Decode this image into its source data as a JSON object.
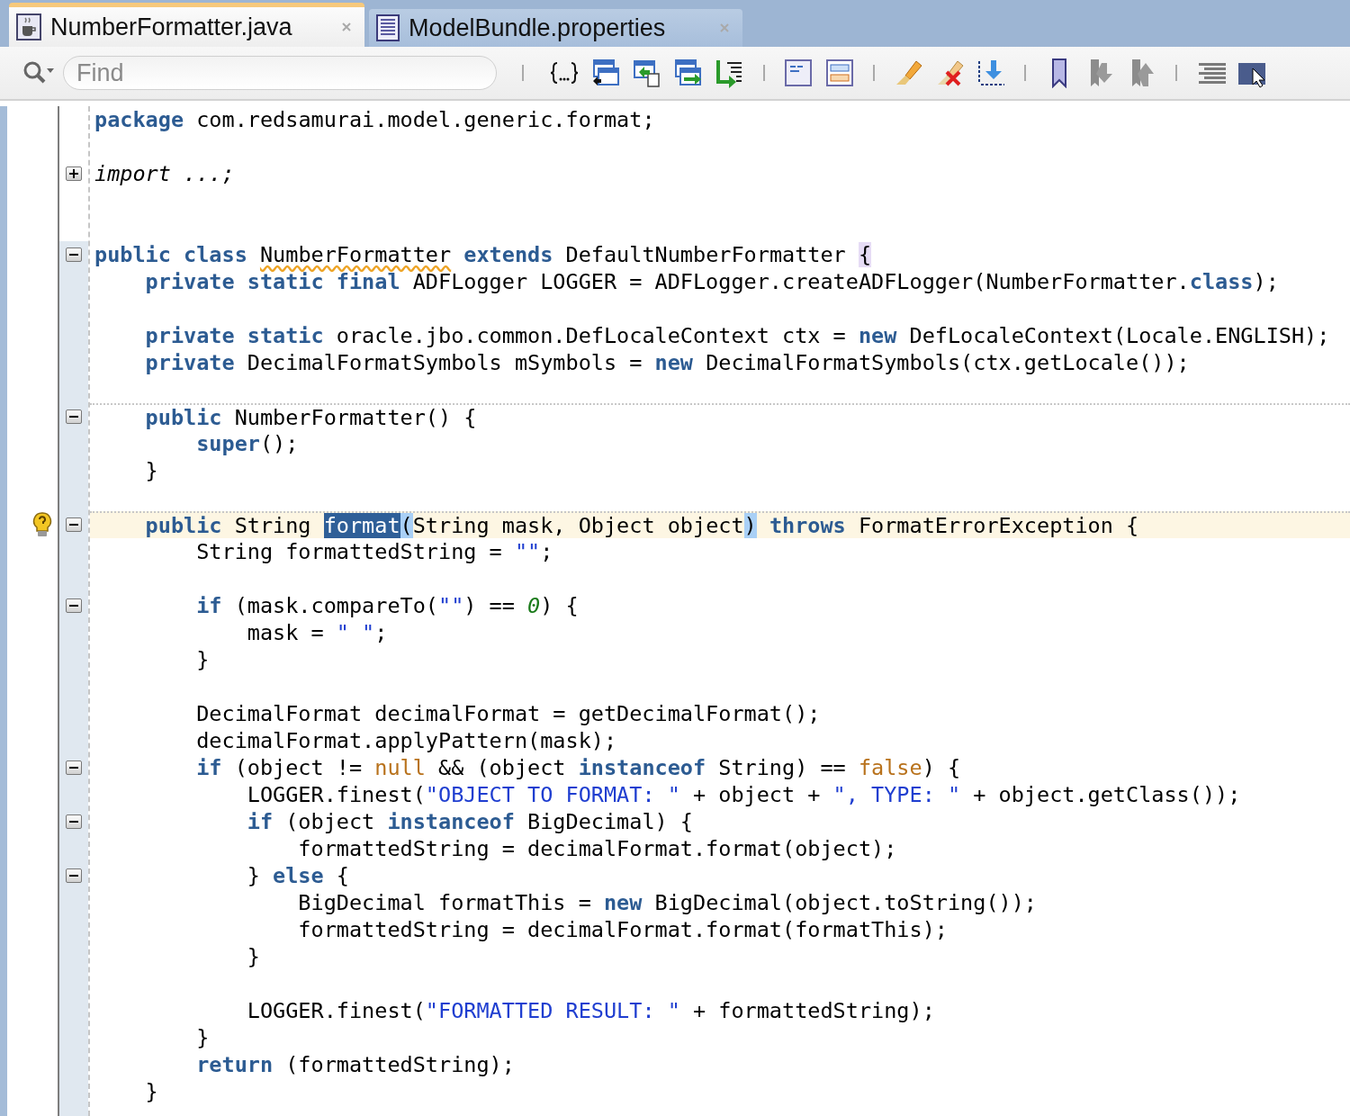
{
  "tabs": [
    {
      "label": "NumberFormatter.java",
      "kind": "java",
      "selected": true
    },
    {
      "label": "ModelBundle.properties",
      "kind": "properties",
      "selected": false
    }
  ],
  "search": {
    "placeholder": "Find"
  },
  "code": [
    {
      "kind": "code",
      "tokens": [
        {
          "kind": "keyword",
          "text": "package"
        },
        {
          "kind": "plain",
          "text": " com.redsamurai.model.generic.format;"
        }
      ]
    },
    {
      "kind": "blank"
    },
    {
      "kind": "code",
      "fold_marker": {
        "expanded": false
      },
      "tokens": [
        {
          "kind": "italic",
          "text": "import ...;"
        }
      ]
    },
    {
      "kind": "blank"
    },
    {
      "kind": "blank"
    },
    {
      "kind": "code",
      "fold_marker": {
        "expanded": true
      },
      "tokens": [
        {
          "kind": "keyword",
          "text": "public class "
        },
        {
          "kind": "warning",
          "text": "NumberFormatter"
        },
        {
          "kind": "keyword",
          "text": " extends"
        },
        {
          "kind": "plain",
          "text": " DefaultNumberFormatter "
        },
        {
          "kind": "brace",
          "text": "{"
        }
      ]
    },
    {
      "kind": "code",
      "tokens": [
        {
          "kind": "keyword",
          "text": "    private static final"
        },
        {
          "kind": "plain",
          "text": " ADFLogger LOGGER = ADFLogger.createADFLogger(NumberFormatter."
        },
        {
          "kind": "keyword",
          "text": "class"
        },
        {
          "kind": "plain",
          "text": ");"
        }
      ]
    },
    {
      "kind": "blank"
    },
    {
      "kind": "code",
      "tokens": [
        {
          "kind": "keyword",
          "text": "    private static"
        },
        {
          "kind": "plain",
          "text": " oracle.jbo.common.DefLocaleContext ctx = "
        },
        {
          "kind": "keyword",
          "text": "new"
        },
        {
          "kind": "plain",
          "text": " DefLocaleContext(Locale.ENGLISH);"
        }
      ]
    },
    {
      "kind": "code",
      "tokens": [
        {
          "kind": "keyword",
          "text": "    private"
        },
        {
          "kind": "plain",
          "text": " DecimalFormatSymbols mSymbols = "
        },
        {
          "kind": "keyword",
          "text": "new"
        },
        {
          "kind": "plain",
          "text": " DecimalFormatSymbols(ctx.getLocale());"
        }
      ]
    },
    {
      "kind": "blank"
    },
    {
      "kind": "code",
      "separator": true,
      "fold_marker": {
        "expanded": true
      },
      "tokens": [
        {
          "kind": "keyword",
          "text": "    public"
        },
        {
          "kind": "plain",
          "text": " NumberFormatter() {"
        }
      ]
    },
    {
      "kind": "code",
      "tokens": [
        {
          "kind": "keyword",
          "text": "        super"
        },
        {
          "kind": "plain",
          "text": "();"
        }
      ]
    },
    {
      "kind": "code",
      "tokens": [
        {
          "kind": "plain",
          "text": "    }"
        }
      ]
    },
    {
      "kind": "blank"
    },
    {
      "kind": "code",
      "separator": true,
      "current": true,
      "hint": true,
      "fold_marker": {
        "expanded": true
      },
      "tokens": [
        {
          "kind": "keyword",
          "text": "    public"
        },
        {
          "kind": "plain",
          "text": " String "
        },
        {
          "kind": "selection",
          "text": "format"
        },
        {
          "kind": "match",
          "text": "("
        },
        {
          "kind": "plain",
          "text": "String mask, Object object"
        },
        {
          "kind": "match",
          "text": ")"
        },
        {
          "kind": "keyword",
          "text": " throws"
        },
        {
          "kind": "plain",
          "text": " FormatErrorException {"
        }
      ]
    },
    {
      "kind": "code",
      "tokens": [
        {
          "kind": "plain",
          "text": "        String formattedString = "
        },
        {
          "kind": "string",
          "text": "\"\""
        },
        {
          "kind": "plain",
          "text": ";"
        }
      ]
    },
    {
      "kind": "blank"
    },
    {
      "kind": "code",
      "fold_marker": {
        "expanded": true
      },
      "tokens": [
        {
          "kind": "keyword",
          "text": "        if"
        },
        {
          "kind": "plain",
          "text": " (mask.compareTo("
        },
        {
          "kind": "string",
          "text": "\"\""
        },
        {
          "kind": "plain",
          "text": ") == "
        },
        {
          "kind": "number",
          "text": "0"
        },
        {
          "kind": "plain",
          "text": ") {"
        }
      ]
    },
    {
      "kind": "code",
      "tokens": [
        {
          "kind": "plain",
          "text": "            mask = "
        },
        {
          "kind": "string",
          "text": "\" \""
        },
        {
          "kind": "plain",
          "text": ";"
        }
      ]
    },
    {
      "kind": "code",
      "tokens": [
        {
          "kind": "plain",
          "text": "        }"
        }
      ]
    },
    {
      "kind": "blank"
    },
    {
      "kind": "code",
      "tokens": [
        {
          "kind": "plain",
          "text": "        DecimalFormat decimalFormat = getDecimalFormat();"
        }
      ]
    },
    {
      "kind": "code",
      "tokens": [
        {
          "kind": "plain",
          "text": "        decimalFormat.applyPattern(mask);"
        }
      ]
    },
    {
      "kind": "code",
      "fold_marker": {
        "expanded": true
      },
      "tokens": [
        {
          "kind": "keyword",
          "text": "        if"
        },
        {
          "kind": "plain",
          "text": " (object != "
        },
        {
          "kind": "literal",
          "text": "null"
        },
        {
          "kind": "plain",
          "text": " && (object "
        },
        {
          "kind": "keyword",
          "text": "instanceof"
        },
        {
          "kind": "plain",
          "text": " String) == "
        },
        {
          "kind": "literal",
          "text": "false"
        },
        {
          "kind": "plain",
          "text": ") {"
        }
      ]
    },
    {
      "kind": "code",
      "tokens": [
        {
          "kind": "plain",
          "text": "            LOGGER.finest("
        },
        {
          "kind": "string",
          "text": "\"OBJECT TO FORMAT: \""
        },
        {
          "kind": "plain",
          "text": " + object + "
        },
        {
          "kind": "string",
          "text": "\", TYPE: \""
        },
        {
          "kind": "plain",
          "text": " + object.getClass());"
        }
      ]
    },
    {
      "kind": "code",
      "fold_marker": {
        "expanded": true
      },
      "tokens": [
        {
          "kind": "keyword",
          "text": "            if"
        },
        {
          "kind": "plain",
          "text": " (object "
        },
        {
          "kind": "keyword",
          "text": "instanceof"
        },
        {
          "kind": "plain",
          "text": " BigDecimal) {"
        }
      ]
    },
    {
      "kind": "code",
      "tokens": [
        {
          "kind": "plain",
          "text": "                formattedString = decimalFormat.format(object);"
        }
      ]
    },
    {
      "kind": "code",
      "fold_marker": {
        "expanded": true
      },
      "tokens": [
        {
          "kind": "plain",
          "text": "            } "
        },
        {
          "kind": "keyword",
          "text": "else"
        },
        {
          "kind": "plain",
          "text": " {"
        }
      ]
    },
    {
      "kind": "code",
      "tokens": [
        {
          "kind": "plain",
          "text": "                BigDecimal formatThis = "
        },
        {
          "kind": "keyword",
          "text": "new"
        },
        {
          "kind": "plain",
          "text": " BigDecimal(object.toString());"
        }
      ]
    },
    {
      "kind": "code",
      "tokens": [
        {
          "kind": "plain",
          "text": "                formattedString = decimalFormat.format(formatThis);"
        }
      ]
    },
    {
      "kind": "code",
      "tokens": [
        {
          "kind": "plain",
          "text": "            }"
        }
      ]
    },
    {
      "kind": "blank"
    },
    {
      "kind": "code",
      "tokens": [
        {
          "kind": "plain",
          "text": "            LOGGER.finest("
        },
        {
          "kind": "string",
          "text": "\"FORMATTED RESULT: \""
        },
        {
          "kind": "plain",
          "text": " + formattedString);"
        }
      ]
    },
    {
      "kind": "code",
      "tokens": [
        {
          "kind": "plain",
          "text": "        }"
        }
      ]
    },
    {
      "kind": "code",
      "tokens": [
        {
          "kind": "keyword",
          "text": "        return"
        },
        {
          "kind": "plain",
          "text": " (formattedString);"
        }
      ]
    },
    {
      "kind": "code",
      "tokens": [
        {
          "kind": "plain",
          "text": "    }"
        }
      ]
    }
  ]
}
